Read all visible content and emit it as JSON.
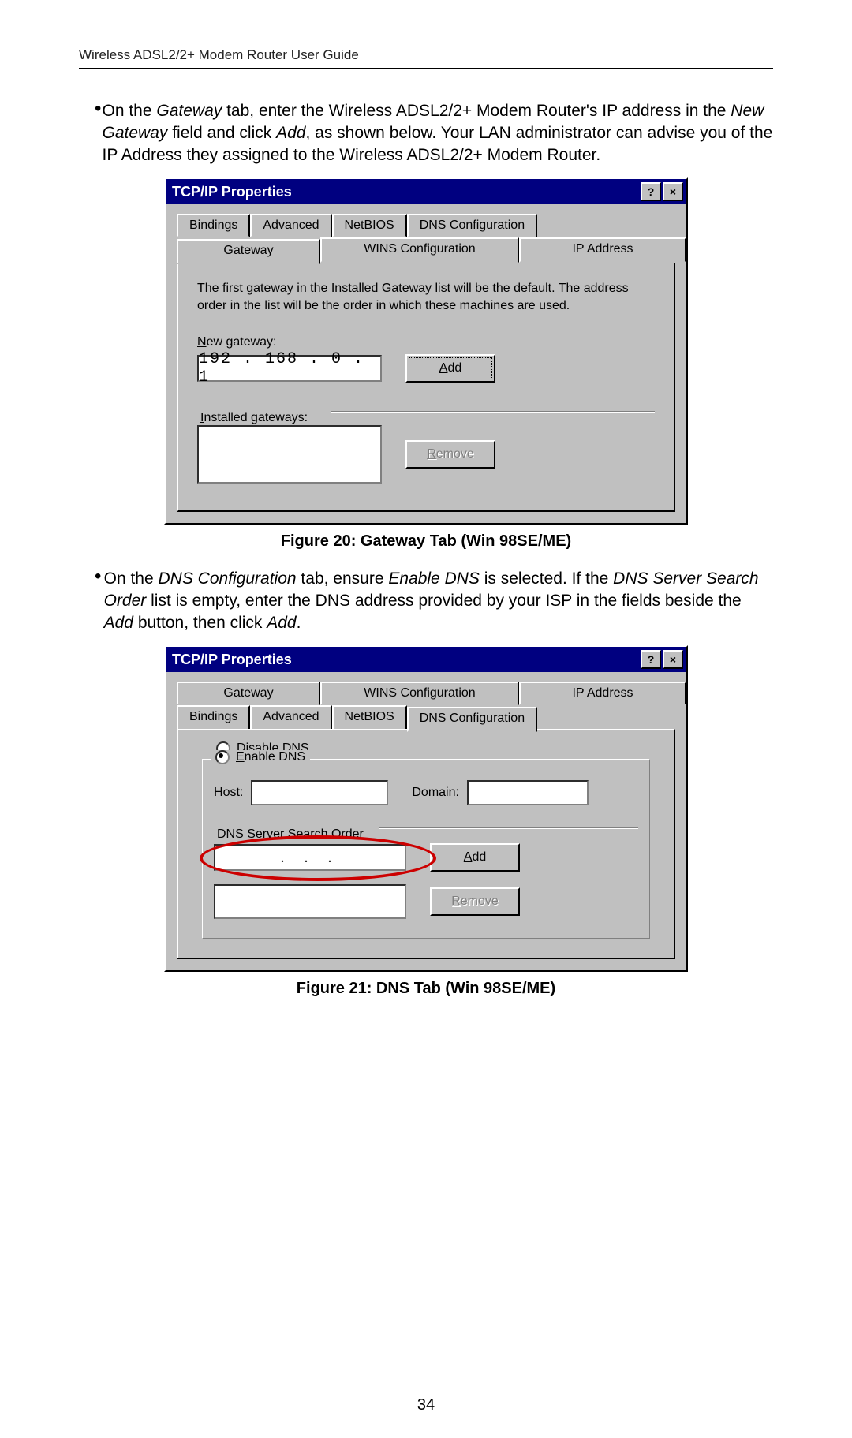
{
  "header": "Wireless ADSL2/2+ Modem Router User Guide",
  "page_number": "34",
  "bullet1_a": "On the ",
  "bullet1_b": "Gateway",
  "bullet1_c": " tab, enter the Wireless ADSL2/2+ Modem Router's IP address in the ",
  "bullet1_d": "New Gateway",
  "bullet1_e": " field and click ",
  "bullet1_f": "Add",
  "bullet1_g": ", as shown below. Your LAN administrator can advise you of the IP Address they assigned to the Wireless ADSL2/2+ Modem Router.",
  "bullet2_a": "On the ",
  "bullet2_b": "DNS Configuration",
  "bullet2_c": " tab, ensure ",
  "bullet2_d": "Enable DNS",
  "bullet2_e": " is selected. If the ",
  "bullet2_f": "DNS Server Search Order",
  "bullet2_g": " list is empty, enter the DNS address provided by your ISP in the fields beside the ",
  "bullet2_h": "Add",
  "bullet2_i": " button, then click ",
  "bullet2_j": "Add",
  "bullet2_k": ".",
  "caption1": "Figure 20: Gateway Tab (Win 98SE/ME)",
  "caption2": "Figure 21: DNS Tab (Win 98SE/ME)",
  "win1": {
    "title": "TCP/IP Properties",
    "help": "?",
    "close": "×",
    "tabs_row1": [
      "Bindings",
      "Advanced",
      "NetBIOS",
      "DNS Configuration"
    ],
    "tabs_row2": [
      "Gateway",
      "WINS Configuration",
      "IP Address"
    ],
    "desc": "The first gateway in the Installed Gateway list will be the default. The address order in the list will be the order in which these machines are used.",
    "new_gateway_label": "New gateway:",
    "ip_value": "192 . 168 .   0   .   1",
    "add_label": "Add",
    "installed_label": "Installed gateways:",
    "remove_label": "Remove"
  },
  "win2": {
    "title": "TCP/IP Properties",
    "help": "?",
    "close": "×",
    "tabs_row1": [
      "Gateway",
      "WINS Configuration",
      "IP Address"
    ],
    "tabs_row2": [
      "Bindings",
      "Advanced",
      "NetBIOS",
      "DNS Configuration"
    ],
    "disable_label": "Disable DNS",
    "enable_label": "Enable DNS",
    "host_label": "Host:",
    "domain_label": "Domain:",
    "search_label": "DNS Server Search Order",
    "ip_value": " .       .       . ",
    "add_label": "Add",
    "remove_label": "Remove"
  }
}
